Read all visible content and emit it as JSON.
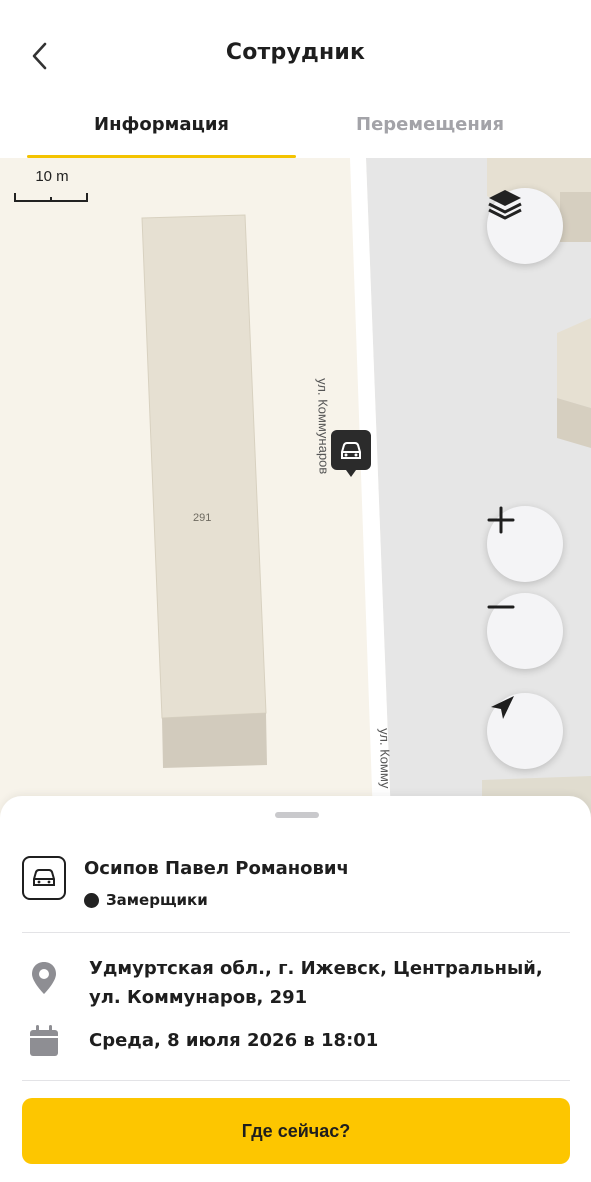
{
  "header": {
    "title": "Сотрудник",
    "back_icon": "chevron-left-icon"
  },
  "tabs": [
    {
      "label": "Информация",
      "active": true
    },
    {
      "label": "Перемещения",
      "active": false
    }
  ],
  "colors": {
    "accent": "#fdc600",
    "tab_inactive": "#a3a3a8",
    "map_background": "#f7f3ea",
    "map_road_area": "#e6e6e6",
    "building": "#e6e0d2"
  },
  "map": {
    "scale_label": "10 m",
    "street_label_1": "ул. Коммунаров",
    "street_label_2": "ул. Комму",
    "house_number": "291",
    "buttons": {
      "layers_icon": "layers-icon",
      "zoom_in_icon": "plus-icon",
      "zoom_out_icon": "minus-icon",
      "locate_icon": "navigation-arrow-icon"
    },
    "marker_icon": "car-icon"
  },
  "employee": {
    "name": "Осипов Павел Романович",
    "group": "Замерщики",
    "address": "Удмуртская обл., г. Ижевск, Центральный, ул. Коммунаров, 291",
    "datetime": "Среда, 8 июля 2026 в 18:01"
  },
  "actions": {
    "where_now_label": "Где сейчас?"
  }
}
